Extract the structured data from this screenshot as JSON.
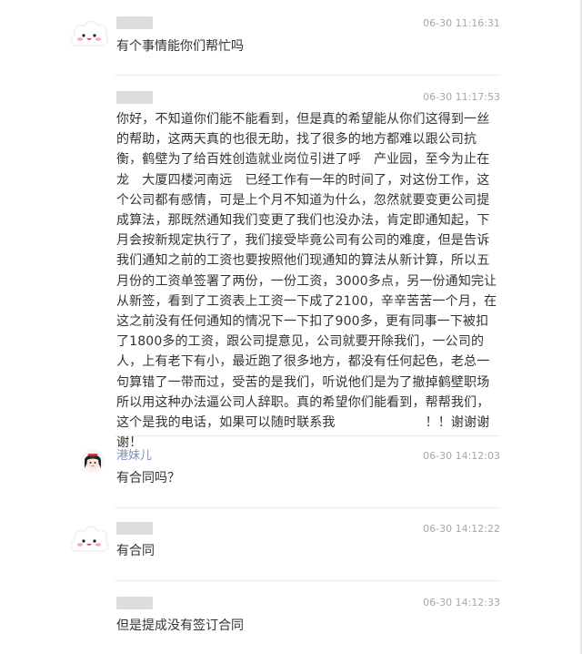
{
  "comments": [
    {
      "author": "",
      "avatar": "cloud-avatar",
      "timestamp": "06-30 11:16:31",
      "text": "有个事情能你们帮忙吗"
    },
    {
      "author": "",
      "avatar": "none",
      "timestamp": "06-30 11:17:53",
      "text": "你好，不知道你们能不能看到，但是真的希望能从你们这得到一丝的帮助，这两天真的也很无助，找了很多的地方都难以跟公司抗衡，鹤壁为了给百姓创造就业岗位引进了呼　产业园，至今为止在龙　大厦四楼河南远　已经工作有一年的时间了，对这份工作，这个公司都有感情，可是上个月不知道为什么，忽然就要变更公司提成算法，那既然通知我们变更了我们也没办法，肯定即通知起，下月会按新规定执行了，我们接受毕竟公司有公司的难度，但是告诉我们通知之前的工资也要按照他们现通知的算法从新计算，所以五月份的工资单签署了两份，一份工资，3000多点，另一份通知完让从新签，看到了工资表上工资一下成了2100，辛辛苦苦一个月，在这之前没有任何通知的情况下一下扣了900多，更有同事一下被扣了1800多的工资，跟公司提意见，公司就要开除我们，一公司的人，上有老下有小，最近跑了很多地方，都没有任何起色，老总一句算错了一带而过，受苦的是我们，听说他们是为了撤掉鹤壁职场所以用这种办法逼公司人辞职。真的希望你们能看到，帮帮我们，这个是我的电话，如果可以随时联系我　　　　　　　！！谢谢谢谢！"
    },
    {
      "author": "港妹儿",
      "avatar": "girl-avatar",
      "timestamp": "06-30 14:12:03",
      "text": "有合同吗？"
    },
    {
      "author": "",
      "avatar": "cloud-avatar",
      "timestamp": "06-30 14:12:22",
      "text": "有合同"
    },
    {
      "author": "",
      "avatar": "none",
      "timestamp": "06-30 14:12:33",
      "text": "但是提成没有签订合同"
    }
  ],
  "colors": {
    "author": "#7b93b6",
    "timestamp": "#a7a7a7",
    "text": "#333333",
    "divider": "#eaeaea",
    "cloud_blush": "#f4a9bd"
  }
}
